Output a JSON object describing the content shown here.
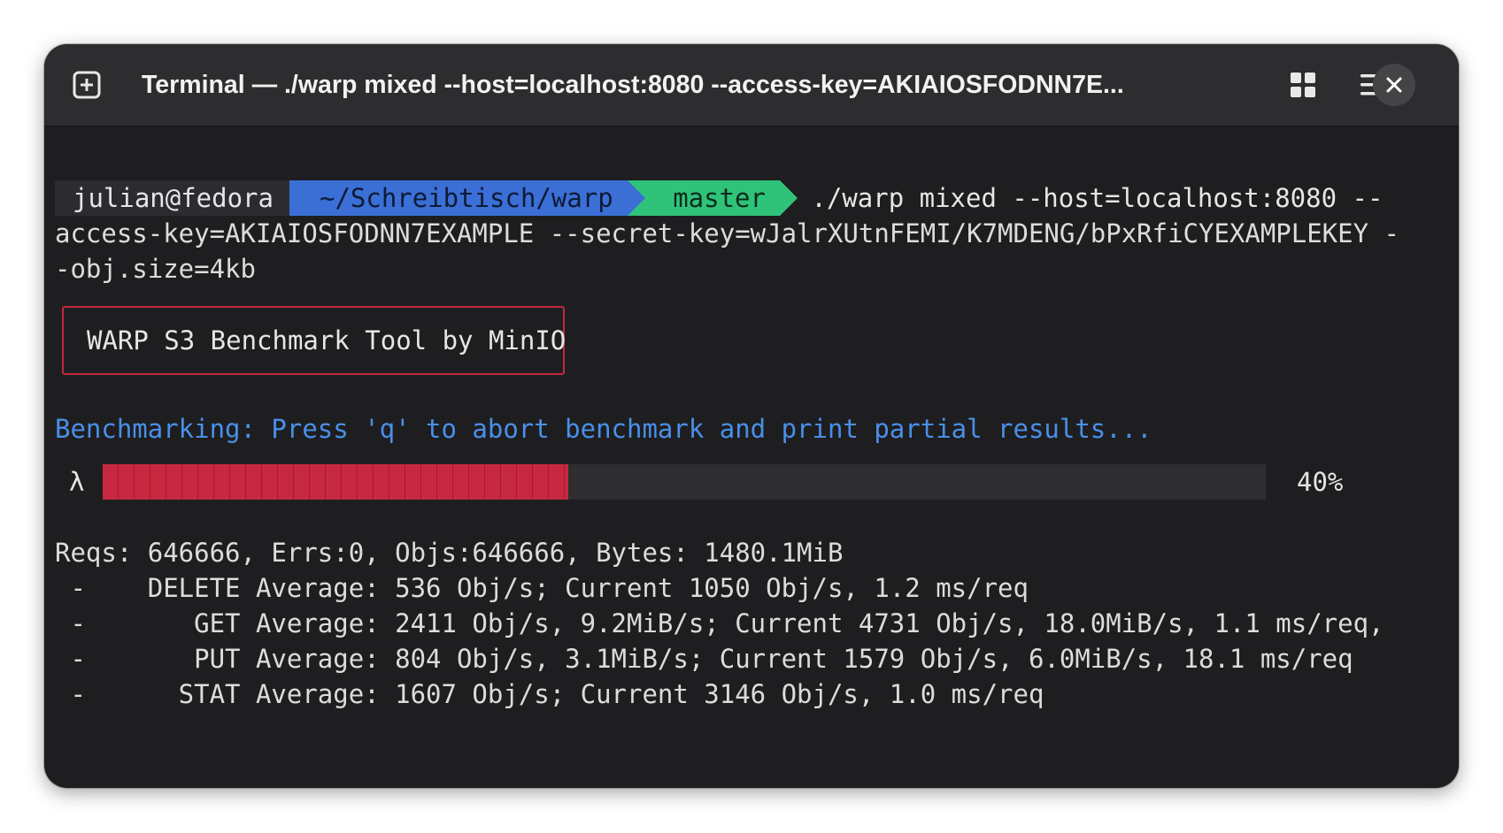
{
  "window": {
    "title": "Terminal — ./warp mixed --host=localhost:8080 --access-key=AKIAIOSFODNN7E..."
  },
  "icons": {
    "new_tab": "new-tab-icon",
    "grid": "grid-icon",
    "menu": "hamburger-menu-icon",
    "close": "close-icon"
  },
  "prompt": {
    "user": "julian@fedora",
    "path": "~/Schreibtisch/warp",
    "branch_symbol": "",
    "branch": "master",
    "command_line_1": " ./warp mixed --host=localhost:8080 --",
    "command_line_2": "access-key=AKIAIOSFODNN7EXAMPLE --secret-key=wJalrXUtnFEMI/K7MDENG/bPxRfiCYEXAMPLEKEY -",
    "command_line_3": "-obj.size=4kb"
  },
  "banner": "WARP S3 Benchmark Tool by MinIO",
  "status_line": "Benchmarking: Press 'q' to abort benchmark and print partial results...",
  "progress": {
    "symbol": "λ",
    "fraction": 0.4,
    "label": "40%"
  },
  "stats": {
    "summary": "Reqs: 646666, Errs:0, Objs:646666, Bytes: 1480.1MiB",
    "lines": [
      " -    DELETE Average: 536 Obj/s; Current 1050 Obj/s, 1.2 ms/req",
      " -       GET Average: 2411 Obj/s, 9.2MiB/s; Current 4731 Obj/s, 18.0MiB/s, 1.1 ms/req,",
      " -       PUT Average: 804 Obj/s, 3.1MiB/s; Current 1579 Obj/s, 6.0MiB/s, 18.1 ms/req",
      " -      STAT Average: 1607 Obj/s; Current 3146 Obj/s, 1.0 ms/req"
    ]
  },
  "colors": {
    "accent_red": "#c7283f",
    "prompt_blue": "#3b6fd6",
    "prompt_green": "#2fc37a",
    "info_blue": "#4a8fe8"
  }
}
